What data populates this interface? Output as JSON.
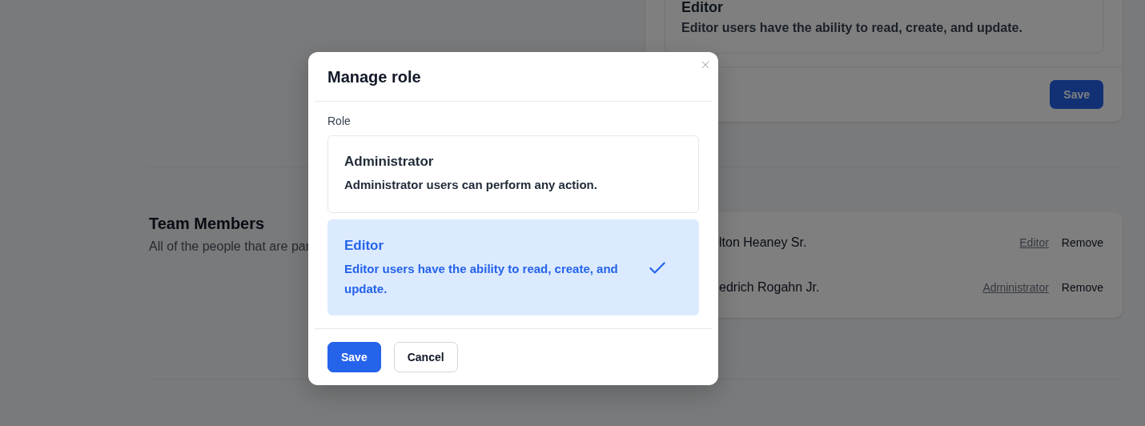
{
  "background": {
    "role_card": {
      "role_title": "Editor",
      "role_description": "Editor users have the ability to read, create, and update.",
      "save_button": "Save"
    },
    "team_section": {
      "title": "Team Members",
      "description": "All of the people that are par",
      "members": [
        {
          "name": "lton Heaney Sr.",
          "role": "Editor",
          "remove": "Remove"
        },
        {
          "name": "edrich Rogahn Jr.",
          "role": "Administrator",
          "remove": "Remove"
        }
      ]
    }
  },
  "dialog": {
    "title": "Manage role",
    "field_label": "Role",
    "options": [
      {
        "title": "Administrator",
        "description": "Administrator users can perform any action.",
        "selected": false
      },
      {
        "title": "Editor",
        "description": "Editor users have the ability to read, create, and update.",
        "selected": true
      }
    ],
    "buttons": [
      {
        "label": "Save",
        "kind": "primary"
      },
      {
        "label": "Cancel",
        "kind": "secondary"
      }
    ]
  }
}
